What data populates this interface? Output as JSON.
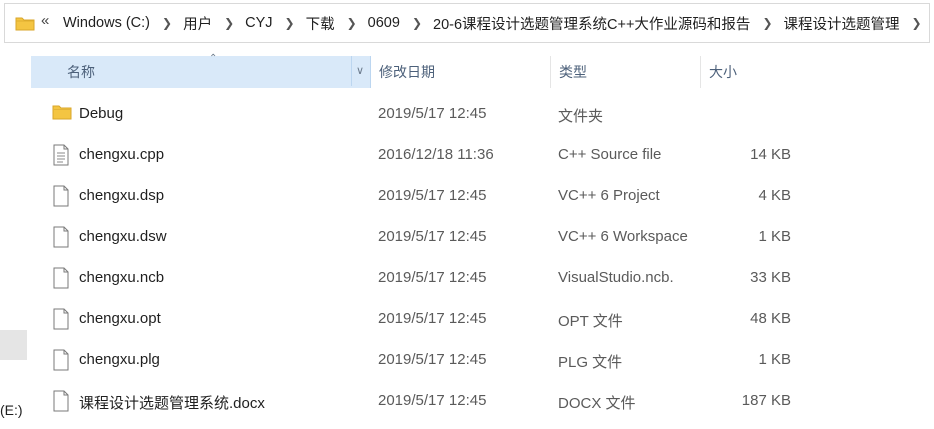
{
  "address_bar": {
    "overflow": "«",
    "crumbs": [
      "Windows (C:)",
      "用户",
      "CYJ",
      "下载",
      "0609",
      "20-6课程设计选题管理系统C++大作业源码和报告",
      "课程设计选题管理"
    ]
  },
  "nav": {
    "drive_label": "(E:)"
  },
  "columns": {
    "name": "名称",
    "date": "修改日期",
    "type": "类型",
    "size": "大小"
  },
  "files": [
    {
      "icon": "folder-icon",
      "name": "Debug",
      "date": "2019/5/17 12:45",
      "type": "文件夹",
      "size": ""
    },
    {
      "icon": "text-file-icon",
      "name": "chengxu.cpp",
      "date": "2016/12/18 11:36",
      "type": "C++ Source file",
      "size": "14 KB"
    },
    {
      "icon": "file-icon",
      "name": "chengxu.dsp",
      "date": "2019/5/17 12:45",
      "type": "VC++ 6 Project",
      "size": "4 KB"
    },
    {
      "icon": "file-icon",
      "name": "chengxu.dsw",
      "date": "2019/5/17 12:45",
      "type": "VC++ 6 Workspace",
      "size": "1 KB"
    },
    {
      "icon": "file-icon",
      "name": "chengxu.ncb",
      "date": "2019/5/17 12:45",
      "type": "VisualStudio.ncb.",
      "size": "33 KB"
    },
    {
      "icon": "file-icon",
      "name": "chengxu.opt",
      "date": "2019/5/17 12:45",
      "type": "OPT 文件",
      "size": "48 KB"
    },
    {
      "icon": "file-icon",
      "name": "chengxu.plg",
      "date": "2019/5/17 12:45",
      "type": "PLG 文件",
      "size": "1 KB"
    },
    {
      "icon": "file-icon",
      "name": "课程设计选题管理系统.docx",
      "date": "2019/5/17 12:45",
      "type": "DOCX 文件",
      "size": "187 KB"
    }
  ],
  "colors": {
    "header_selected": "#d9e9f9",
    "folder": "#f4c542"
  }
}
